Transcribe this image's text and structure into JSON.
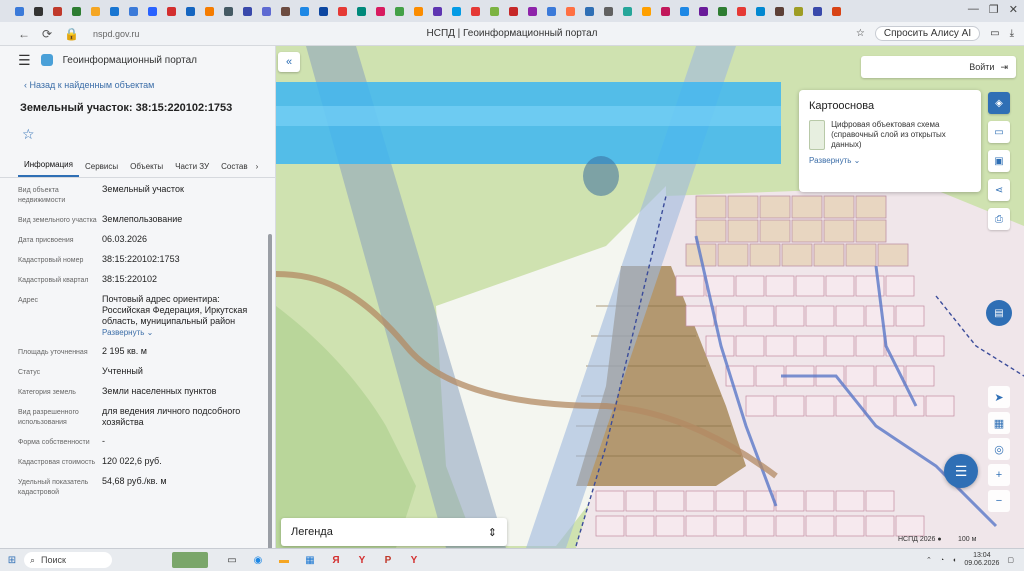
{
  "browser": {
    "url": "nspd.gov.ru",
    "page_title": "НСПД | Геоинформационный портал",
    "alisa": "Спросить Алису AI",
    "tab_favicon_colors": [
      "#3b7ad9",
      "#333333",
      "#c0392b",
      "#2e7d32",
      "#f5a623",
      "#1976d2",
      "#3b7ad9",
      "#2962ff",
      "#d32f2f",
      "#1565c0",
      "#f57c00",
      "#455a64",
      "#3949ab",
      "#5e6ad2",
      "#6d4c41",
      "#1e88e5",
      "#0d47a1",
      "#e53935",
      "#00897b",
      "#d81b60",
      "#43a047",
      "#fb8c00",
      "#5e35b1",
      "#039be5",
      "#e53935",
      "#7cb342",
      "#c62828",
      "#8e24aa",
      "#3b7ad9",
      "#ff7043",
      "#2f6fb5",
      "#616161",
      "#26a69a",
      "#ffa000",
      "#c2185b",
      "#1e88e5",
      "#6a1b9a",
      "#2e7d32",
      "#e53935",
      "#0288d1",
      "#5d4037",
      "#9e9d24",
      "#3949ab",
      "#d84315"
    ]
  },
  "panel": {
    "portal_name": "Геоинформационный портал",
    "back_link": "Назад к найденным объектам",
    "object_title": "Земельный участок: 38:15:220102:1753",
    "tabs": [
      "Информация",
      "Сервисы",
      "Объекты",
      "Части ЗУ",
      "Состав"
    ],
    "expand_label": "Развернуть",
    "properties": [
      {
        "key": "Вид объекта недвижимости",
        "value": "Земельный участок"
      },
      {
        "key": "Вид земельного участка",
        "value": "Землепользование"
      },
      {
        "key": "Дата присвоения",
        "value": "06.03.2026"
      },
      {
        "key": "Кадастровый номер",
        "value": "38:15:220102:1753"
      },
      {
        "key": "Кадастровый квартал",
        "value": "38:15:220102"
      },
      {
        "key": "Адрес",
        "value": "Почтовый адрес ориентира: Российская Федерация, Иркутская область, муниципальный район"
      },
      {
        "key": "Площадь уточненная",
        "value": "2 195 кв. м"
      },
      {
        "key": "Статус",
        "value": "Учтенный"
      },
      {
        "key": "Категория земель",
        "value": "Земли населенных пунктов"
      },
      {
        "key": "Вид разрешенного использования",
        "value": "для ведения личного подсобного хозяйства"
      },
      {
        "key": "Форма собственности",
        "value": "-"
      },
      {
        "key": "Кадастровая стоимость",
        "value": "120 022,6 руб."
      },
      {
        "key": "Удельный показатель кадастровой",
        "value": "54,68 руб./кв. м"
      }
    ]
  },
  "map": {
    "login_label": "Войти",
    "basemap_title": "Картооснова",
    "basemap_desc": "Цифровая объектовая схема (справочный слой из открытых данных)",
    "basemap_expand": "Развернуть",
    "legend_label": "Легенда",
    "attribution": "НСПД 2026 ●",
    "scale": "100 м"
  },
  "taskbar": {
    "search_label": "Поиск",
    "time": "13:04",
    "date": "09.06.2026"
  }
}
